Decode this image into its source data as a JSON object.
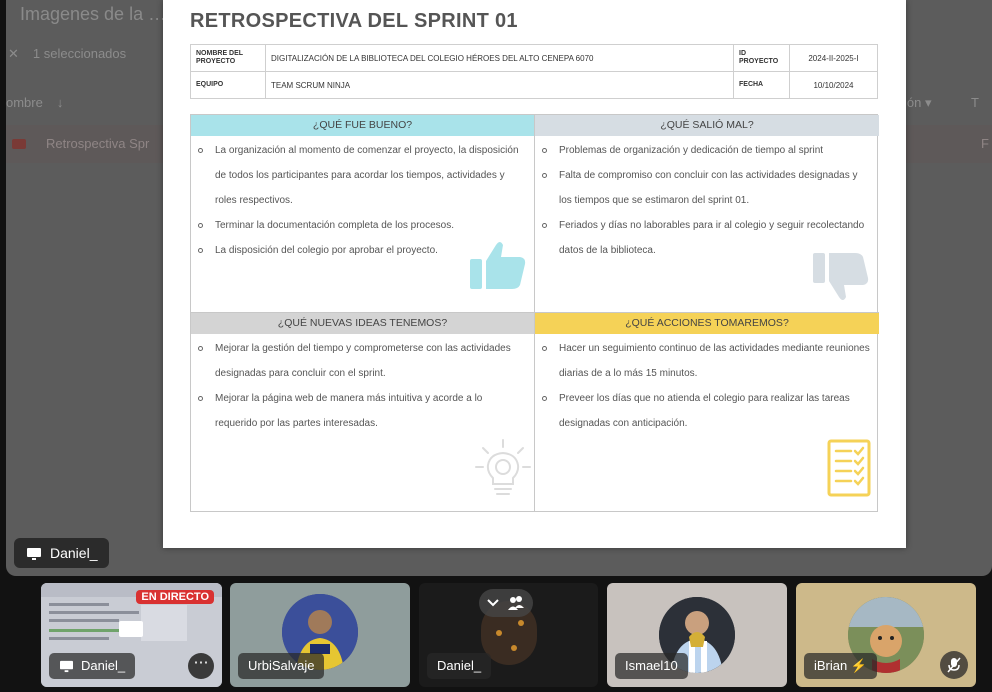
{
  "background_app": {
    "title_partial": "Imagenes de la …",
    "selection_text": "1 seleccionados",
    "close_glyph": "✕",
    "column_name": "ombre",
    "sort_arrow": "↓",
    "column_right": "ión ▾",
    "column_right2": "T",
    "row_file_label": "Retrospectiva Spr",
    "row_right": "F"
  },
  "document": {
    "title": "RETROSPECTIVA DEL SPRINT 01",
    "info": {
      "project_name_label": "NOMBRE DEL PROYECTO",
      "project_name": "DIGITALIZACIÓN DE LA BIBLIOTECA DEL COLEGIO HÉROES DEL ALTO CENEPA 6070",
      "project_id_label": "ID PROYECTO",
      "project_id": "2024-II-2025-I",
      "team_label": "EQUIPO",
      "team": "TEAM SCRUM NINJA",
      "date_label": "FECHA",
      "date": "10/10/2024"
    },
    "quadrants": [
      {
        "header": "¿QUÉ FUE BUENO?",
        "color": "#a9e3ea",
        "icon": "thumbs-up-icon",
        "items": [
          "La organización al momento de comenzar el proyecto, la disposición de todos los participantes para acordar los tiempos, actividades y roles respectivos.",
          "Terminar la documentación completa de los procesos.",
          "La disposición del colegio por aprobar el proyecto."
        ]
      },
      {
        "header": "¿QUÉ SALIÓ MAL?",
        "color": "#d6dde3",
        "icon": "thumbs-down-icon",
        "items": [
          "Problemas de organización y dedicación de tiempo al sprint",
          "Falta de compromiso con concluir con las actividades designadas y los tiempos que se estimaron del sprint 01.",
          "Feriados y días no laborables para ir al colegio y seguir recolectando datos de la biblioteca."
        ]
      },
      {
        "header": "¿QUÉ NUEVAS IDEAS TENEMOS?",
        "color": "#d4d4d4",
        "icon": "lightbulb-icon",
        "items": [
          "Mejorar la gestión del tiempo y comprometerse con las actividades designadas para concluir con el sprint.",
          "Mejorar la página web de manera más intuitiva y acorde a lo requerido por las partes interesadas."
        ]
      },
      {
        "header": "¿QUÉ ACCIONES TOMAREMOS?",
        "color": "#f5d257",
        "icon": "checklist-icon",
        "items": [
          "Hacer un seguimiento continuo de las actividades mediante reuniones diarias de a lo más 15 minutos.",
          "Preveer los días que no atienda el colegio para realizar las tareas designadas con anticipación."
        ]
      }
    ]
  },
  "presenter": {
    "name": "Daniel_"
  },
  "participants": [
    {
      "name": "Daniel_",
      "badge": "EN DIRECTO",
      "more": "⋯"
    },
    {
      "name": "UrbiSalvaje"
    },
    {
      "name": "Daniel_"
    },
    {
      "name": "Ismael10"
    },
    {
      "name": "iBrian",
      "status_emoji": "⚡"
    }
  ]
}
